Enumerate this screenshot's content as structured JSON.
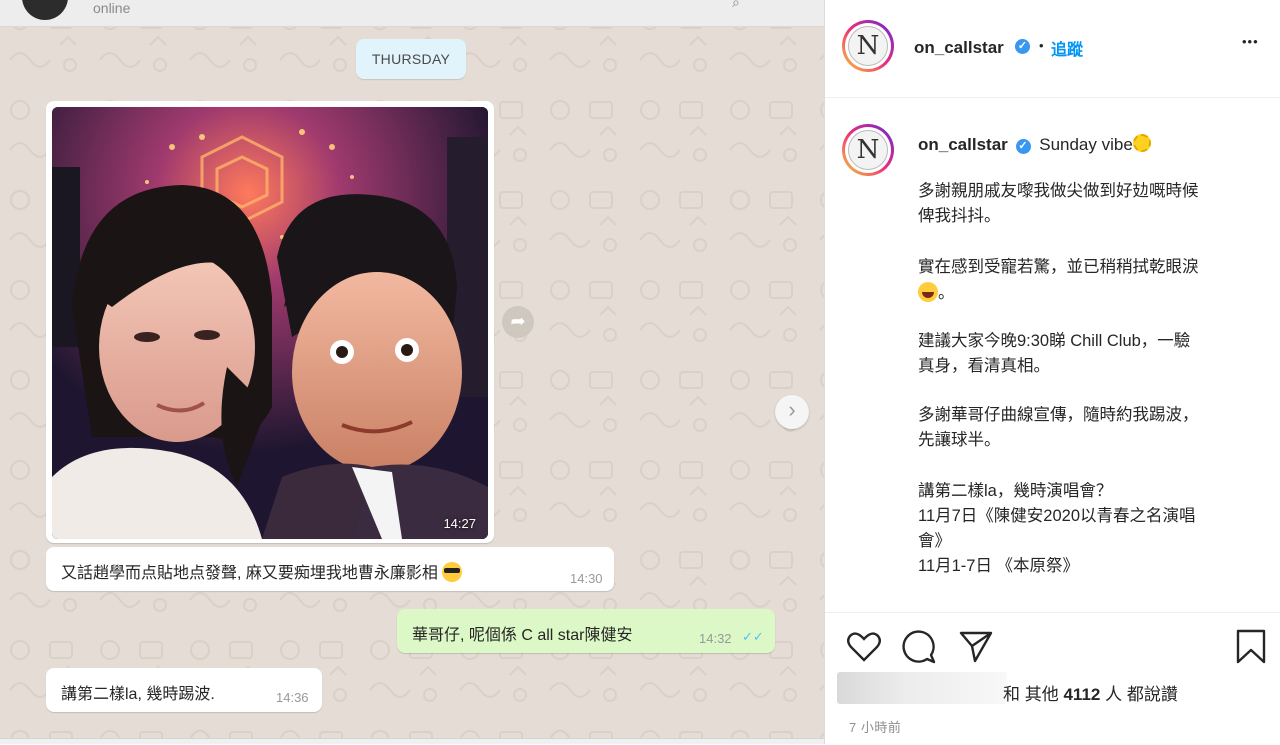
{
  "whatsapp": {
    "header": {
      "status": "online"
    },
    "day_label": "THURSDAY",
    "messages": [
      {
        "type": "photo",
        "time": "14:27"
      },
      {
        "type": "text",
        "direction": "in",
        "text": "又話�POE學而点貼地点發聲, 麻又要痴埋我地曹永廉影相",
        "display": "又話趙學而点貼地点發聲, 麻又要痴埋我地曹永廉影相",
        "emoji": "smiling-face-with-sunglasses",
        "time": "14:30"
      },
      {
        "type": "text",
        "direction": "out",
        "text": "華哥仔, 呢個係 C all star陳健安",
        "time": "14:32",
        "ticks": "✓✓"
      },
      {
        "type": "text",
        "direction": "in",
        "text": "講第二樣la, 幾時踢波.",
        "time": "14:36"
      }
    ],
    "forward_icon": "share-arrow-icon",
    "next_icon": "chevron-right-icon"
  },
  "instagram": {
    "header": {
      "username": "on_callstar",
      "separator": "•",
      "follow_label": "追蹤",
      "more_label": "•••"
    },
    "caption": {
      "username": "on_callstar",
      "head": "Sunday vibe",
      "lines": [
        "多謝親朋戚友嚟我做尖做到好攰嘅時候",
        "俾我抖抖。",
        "實在感到受寵若驚，並已稍稍拭乾眼淚",
        "。",
        "建議大家今晚9:30睇 Chill Club，一驗",
        "真身，看清真相。",
        "多謝華哥仔曲線宣傳，隨時約我踢波，",
        "先讓球半。",
        "講第二樣la，幾時演唱會？",
        "11月7日《陳健安2020以青春之名演唱",
        "會》",
        "11月1-7日 《本原祭》"
      ]
    },
    "actions": [
      "heart-icon",
      "comment-icon",
      "share-icon",
      "bookmark-icon"
    ],
    "likes": {
      "prefix": "和 其他",
      "count": "4112",
      "suffix": "人 都說讚"
    },
    "time_ago": "7 小時前",
    "colors": {
      "accent": "#0095f6",
      "verified": "#3897f0",
      "out_bubble": "#dcf8c6",
      "chat_bg": "#e5ddd5"
    }
  }
}
